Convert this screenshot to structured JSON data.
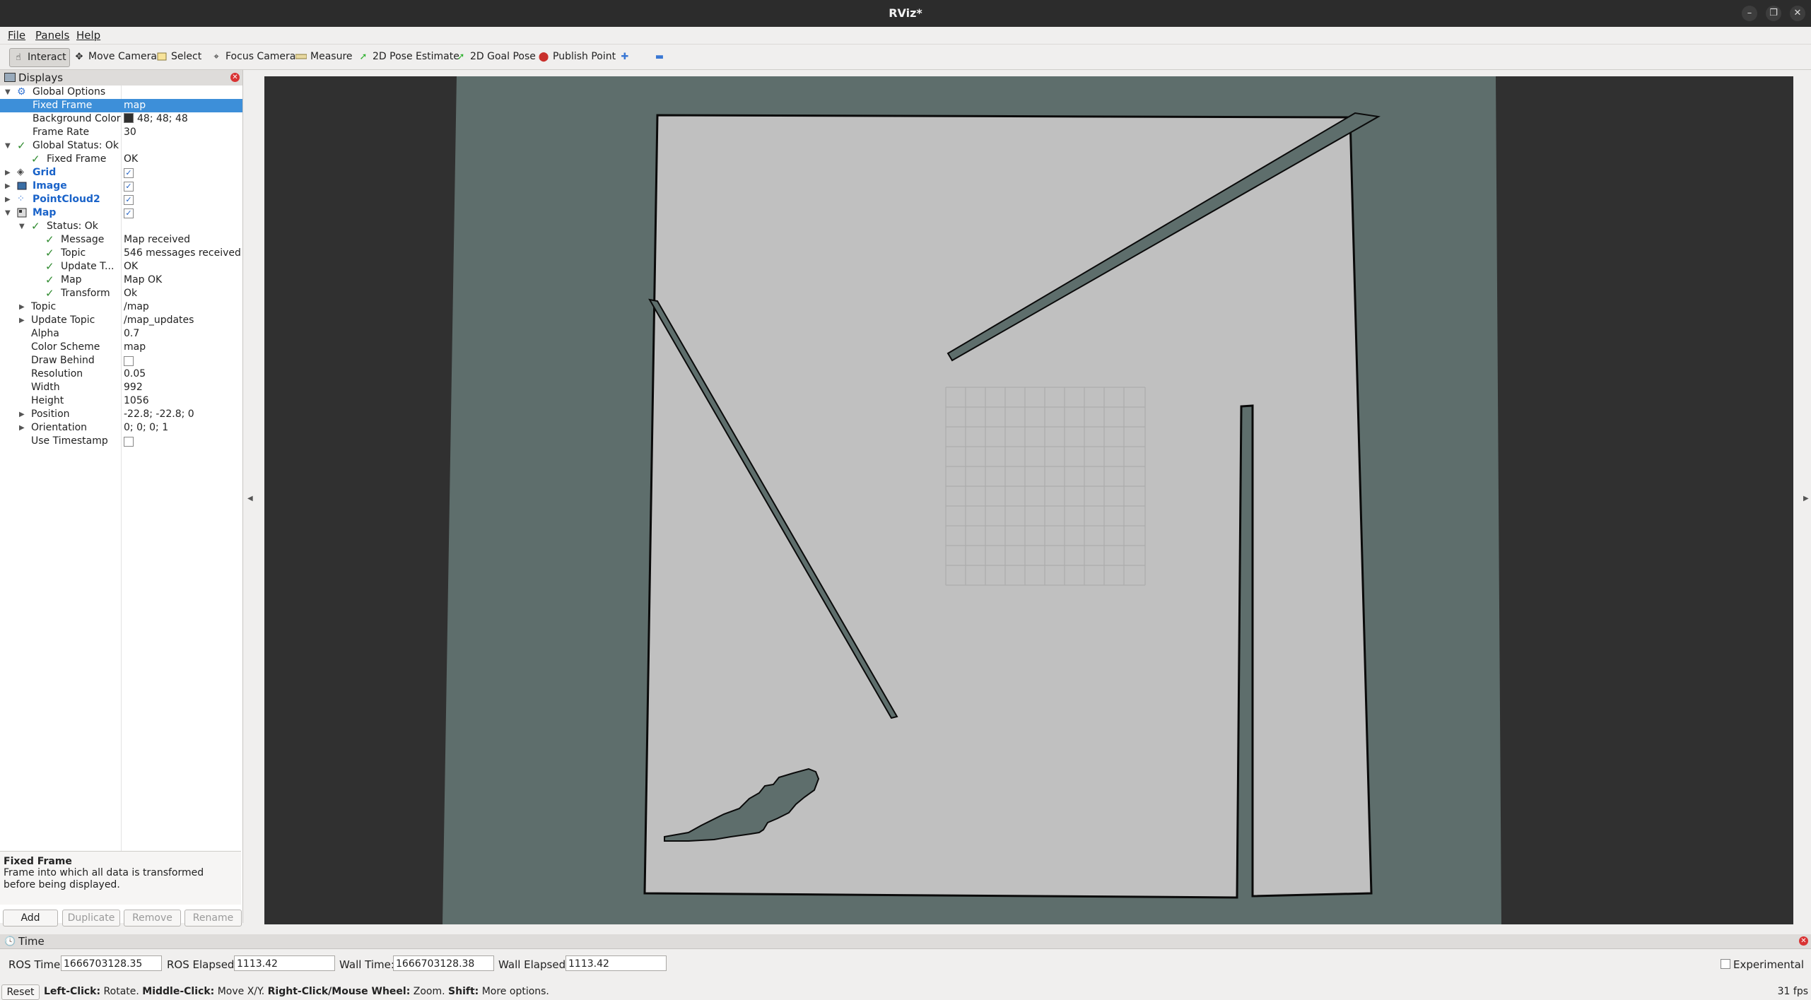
{
  "window": {
    "title": "RViz*"
  },
  "menu": [
    "File",
    "Panels",
    "Help"
  ],
  "toolbar": {
    "tools": [
      {
        "label": "Interact",
        "icon": "hand-icon",
        "active": true
      },
      {
        "label": "Move Camera",
        "icon": "move-camera-icon"
      },
      {
        "label": "Select",
        "icon": "select-box-icon"
      },
      {
        "label": "Focus Camera",
        "icon": "focus-icon"
      },
      {
        "label": "Measure",
        "icon": "ruler-icon"
      },
      {
        "label": "2D Pose Estimate",
        "icon": "green-arrow-icon"
      },
      {
        "label": "2D Goal Pose",
        "icon": "green-arrow-icon"
      },
      {
        "label": "Publish Point",
        "icon": "red-pin-icon"
      }
    ]
  },
  "displays": {
    "title": "Displays",
    "rows": [
      {
        "key": "Global Options",
        "value": ""
      },
      {
        "key": "Fixed Frame",
        "value": "map"
      },
      {
        "key": "Background Color",
        "value": "48; 48; 48"
      },
      {
        "key": "Frame Rate",
        "value": "30"
      },
      {
        "key": "Global Status: Ok",
        "value": ""
      },
      {
        "key": "Fixed Frame",
        "value": "OK"
      },
      {
        "key": "Grid",
        "value": ""
      },
      {
        "key": "Image",
        "value": ""
      },
      {
        "key": "PointCloud2",
        "value": ""
      },
      {
        "key": "Map",
        "value": ""
      },
      {
        "key": "Status: Ok",
        "value": ""
      },
      {
        "key": "Message",
        "value": "Map received"
      },
      {
        "key": "Topic",
        "value": "546 messages received"
      },
      {
        "key": "Update T...",
        "value": "OK"
      },
      {
        "key": "Map",
        "value": "Map OK"
      },
      {
        "key": "Transform",
        "value": "Ok"
      },
      {
        "key": "Topic",
        "value": "/map"
      },
      {
        "key": "Update Topic",
        "value": "/map_updates"
      },
      {
        "key": "Alpha",
        "value": "0.7"
      },
      {
        "key": "Color Scheme",
        "value": "map"
      },
      {
        "key": "Draw Behind",
        "value": ""
      },
      {
        "key": "Resolution",
        "value": "0.05"
      },
      {
        "key": "Width",
        "value": "992"
      },
      {
        "key": "Height",
        "value": "1056"
      },
      {
        "key": "Position",
        "value": "-22.8; -22.8; 0"
      },
      {
        "key": "Orientation",
        "value": "0; 0; 0; 1"
      },
      {
        "key": "Use Timestamp",
        "value": ""
      }
    ],
    "description": {
      "title": "Fixed Frame",
      "text": "Frame into which all data is transformed before being displayed."
    },
    "buttons": {
      "add": "Add",
      "duplicate": "Duplicate",
      "remove": "Remove",
      "rename": "Rename"
    }
  },
  "time": {
    "title": "Time",
    "ros_time_label": "ROS Time:",
    "ros_time": "1666703128.35",
    "ros_elapsed_label": "ROS Elapsed:",
    "ros_elapsed": "1113.42",
    "wall_time_label": "Wall Time:",
    "wall_time": "1666703128.38",
    "wall_elapsed_label": "Wall Elapsed:",
    "wall_elapsed": "1113.42",
    "experimental_label": "Experimental"
  },
  "status": {
    "reset_label": "Reset",
    "hint_left_click": "Left-Click:",
    "hint_left_action": " Rotate. ",
    "hint_middle_click": "Middle-Click:",
    "hint_middle_action": " Move X/Y. ",
    "hint_right_click": "Right-Click/Mouse Wheel:",
    "hint_right_action": " Zoom. ",
    "hint_shift": "Shift:",
    "hint_shift_action": " More options.",
    "fps": "31 fps"
  },
  "colors": {
    "background": "#303030",
    "unknown_cells": "#5e6e6c",
    "free_cells": "#c0c0c0",
    "selection": "#3d8fd9"
  }
}
